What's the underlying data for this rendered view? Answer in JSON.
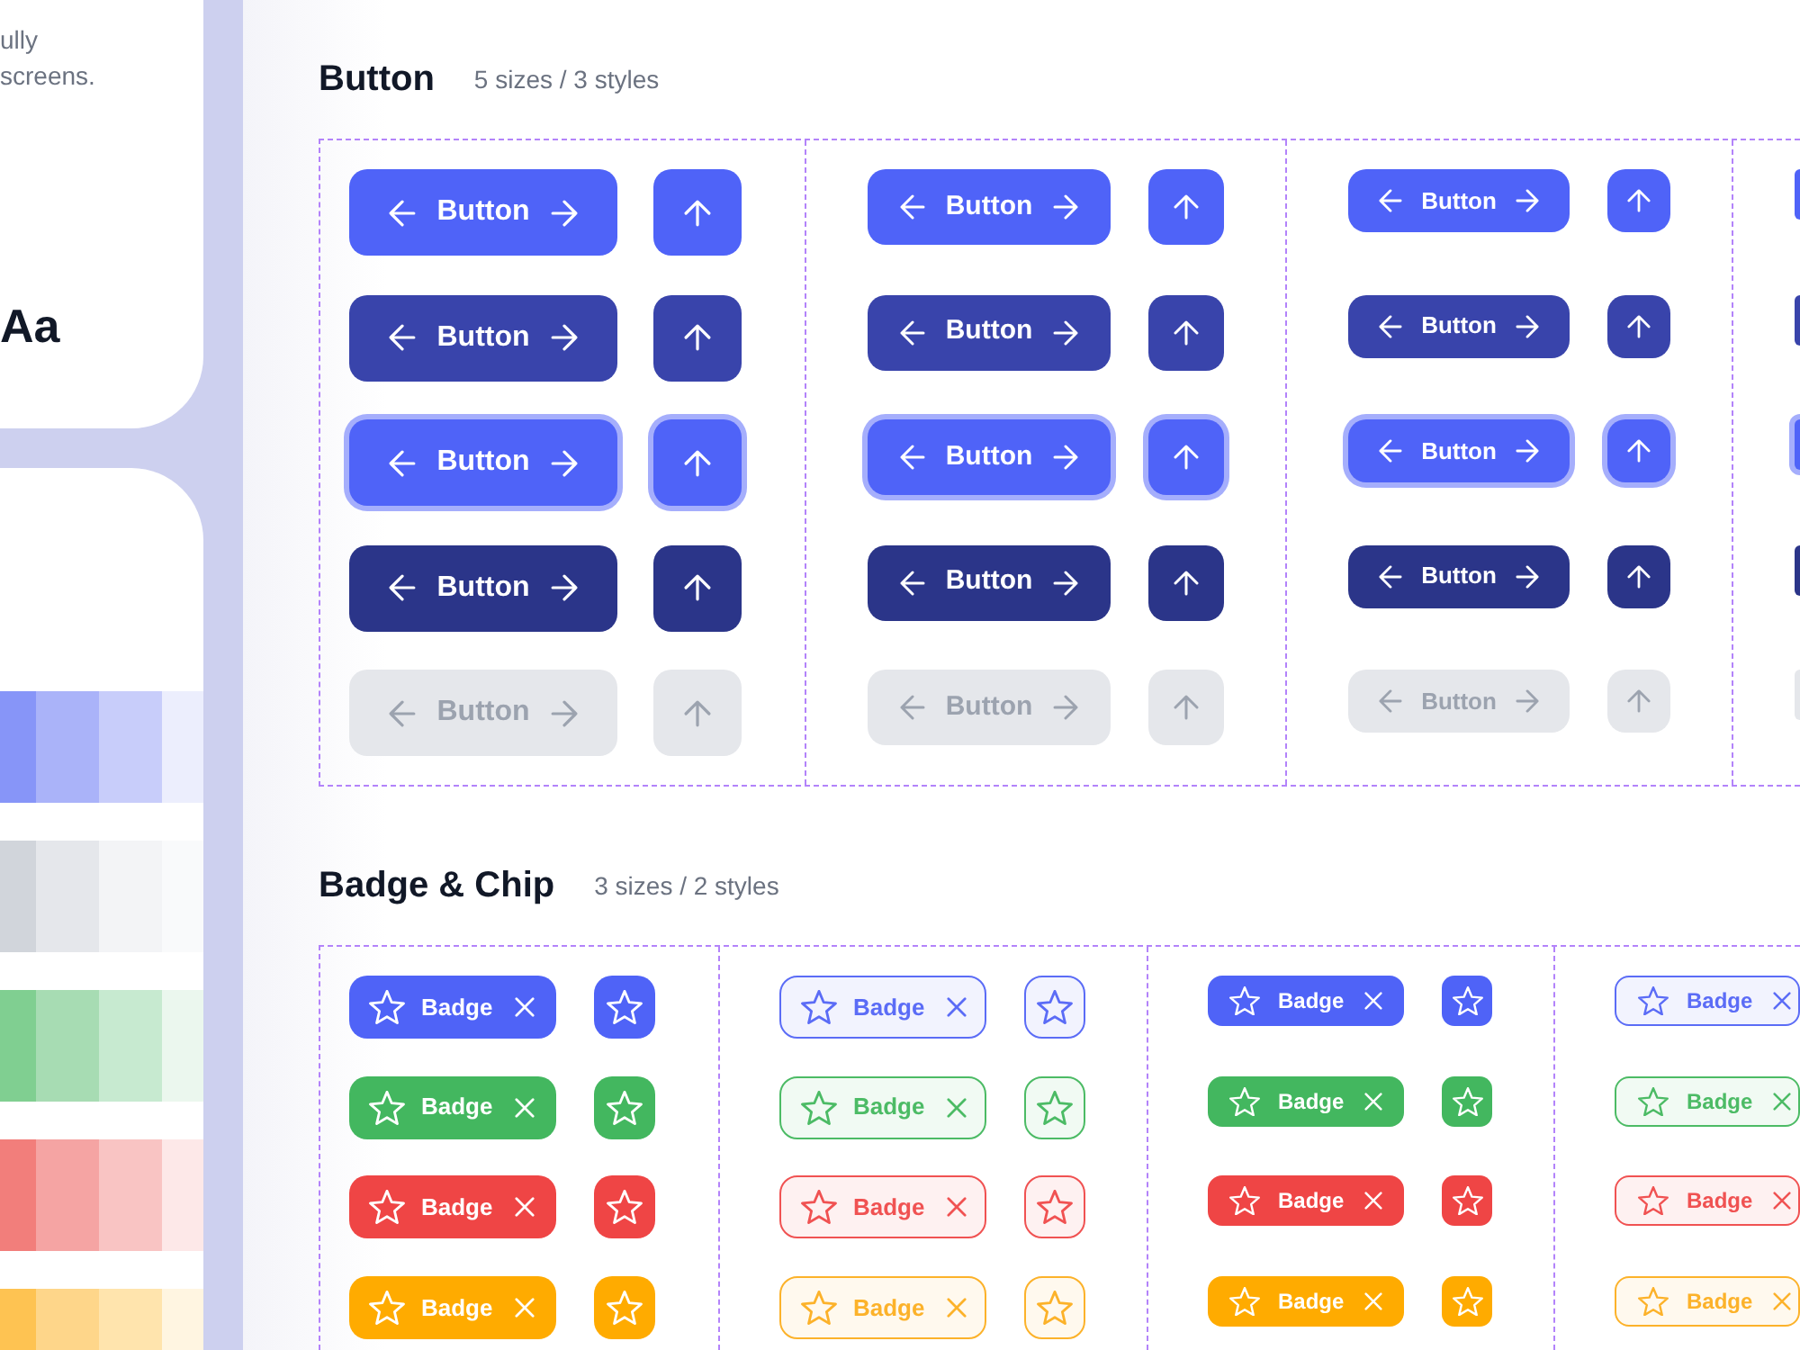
{
  "intro_card": {
    "description_lines": [
      "ully",
      "screens."
    ],
    "type_sample": "Aa"
  },
  "palette": [
    {
      "swatches": [
        {
          "color": "#8795f8"
        },
        {
          "color": "#aab3f9"
        },
        {
          "color": "#c8cdfa"
        },
        {
          "color": "#eceefd"
        }
      ]
    },
    {
      "swatches": [
        {
          "color": "#d1d5db"
        },
        {
          "color": "#e5e7eb"
        },
        {
          "color": "#f3f4f6"
        },
        {
          "color": "#f9fafb"
        }
      ]
    },
    {
      "swatches": [
        {
          "color": "#80cf91"
        },
        {
          "color": "#a7dcb3"
        },
        {
          "color": "#c7ead0"
        },
        {
          "color": "#ebf7ee"
        }
      ]
    },
    {
      "swatches": [
        {
          "color": "#f27e7b"
        },
        {
          "color": "#f5a4a3"
        },
        {
          "color": "#f9c4c3"
        },
        {
          "color": "#fde8e8"
        }
      ]
    },
    {
      "swatches": [
        {
          "color": "#fec352"
        },
        {
          "color": "#fed68a"
        },
        {
          "color": "#ffe4ad"
        },
        {
          "color": "#fff5e1"
        }
      ]
    }
  ],
  "sections": [
    {
      "kind": "buttons",
      "title": "Button",
      "subtitle": "5 sizes / 3 styles",
      "columns": [
        {
          "rows": [
            {
              "kind": "default",
              "label": "Button"
            },
            {
              "kind": "hover",
              "label": "Button"
            },
            {
              "kind": "focus",
              "label": "Button"
            },
            {
              "kind": "pressed",
              "label": "Button"
            },
            {
              "kind": "disabled",
              "label": "Button"
            }
          ]
        },
        {
          "rows": [
            {
              "kind": "default",
              "label": "Button"
            },
            {
              "kind": "hover",
              "label": "Button"
            },
            {
              "kind": "focus",
              "label": "Button"
            },
            {
              "kind": "pressed",
              "label": "Button"
            },
            {
              "kind": "disabled",
              "label": "Button"
            }
          ]
        },
        {
          "rows": [
            {
              "kind": "default",
              "label": "Button"
            },
            {
              "kind": "hover",
              "label": "Button"
            },
            {
              "kind": "focus",
              "label": "Button"
            },
            {
              "kind": "pressed",
              "label": "Button"
            },
            {
              "kind": "disabled",
              "label": "Button"
            }
          ]
        },
        {
          "rows": [
            {
              "kind": "default"
            },
            {
              "kind": "hover"
            },
            {
              "kind": "focus"
            },
            {
              "kind": "pressed"
            },
            {
              "kind": "disabled"
            }
          ]
        }
      ]
    },
    {
      "kind": "badges",
      "title": "Badge & Chip",
      "subtitle": "3 sizes / 2 styles",
      "columns": [
        {
          "kind": "solid",
          "chips": true,
          "rows": [
            {
              "color": "#4f63f7",
              "label": "Badge"
            },
            {
              "color": "#43b75f",
              "label": "Badge"
            },
            {
              "color": "#ef4545",
              "label": "Badge"
            },
            {
              "color": "#ffab00",
              "label": "Badge"
            }
          ]
        },
        {
          "kind": "soft",
          "chips": true,
          "rows": [
            {
              "color": "#5b6cf6",
              "label": "Badge"
            },
            {
              "color": "#4cbb65",
              "label": "Badge"
            },
            {
              "color": "#f05252",
              "label": "Badge"
            },
            {
              "color": "#fcb22a",
              "label": "Badge"
            }
          ]
        },
        {
          "kind": "solid",
          "chips": true,
          "rows": [
            {
              "color": "#4f63f7",
              "label": "Badge"
            },
            {
              "color": "#43b75f",
              "label": "Badge"
            },
            {
              "color": "#ef4545",
              "label": "Badge"
            },
            {
              "color": "#ffab00",
              "label": "Badge"
            }
          ]
        },
        {
          "kind": "soft",
          "chips": false,
          "rows": [
            {
              "color": "#5b6cf6",
              "label": "Badge"
            },
            {
              "color": "#4cbb65",
              "label": "Badge"
            },
            {
              "color": "#f05252",
              "label": "Badge"
            },
            {
              "color": "#fcb22a",
              "label": "Badge"
            }
          ]
        }
      ]
    }
  ]
}
